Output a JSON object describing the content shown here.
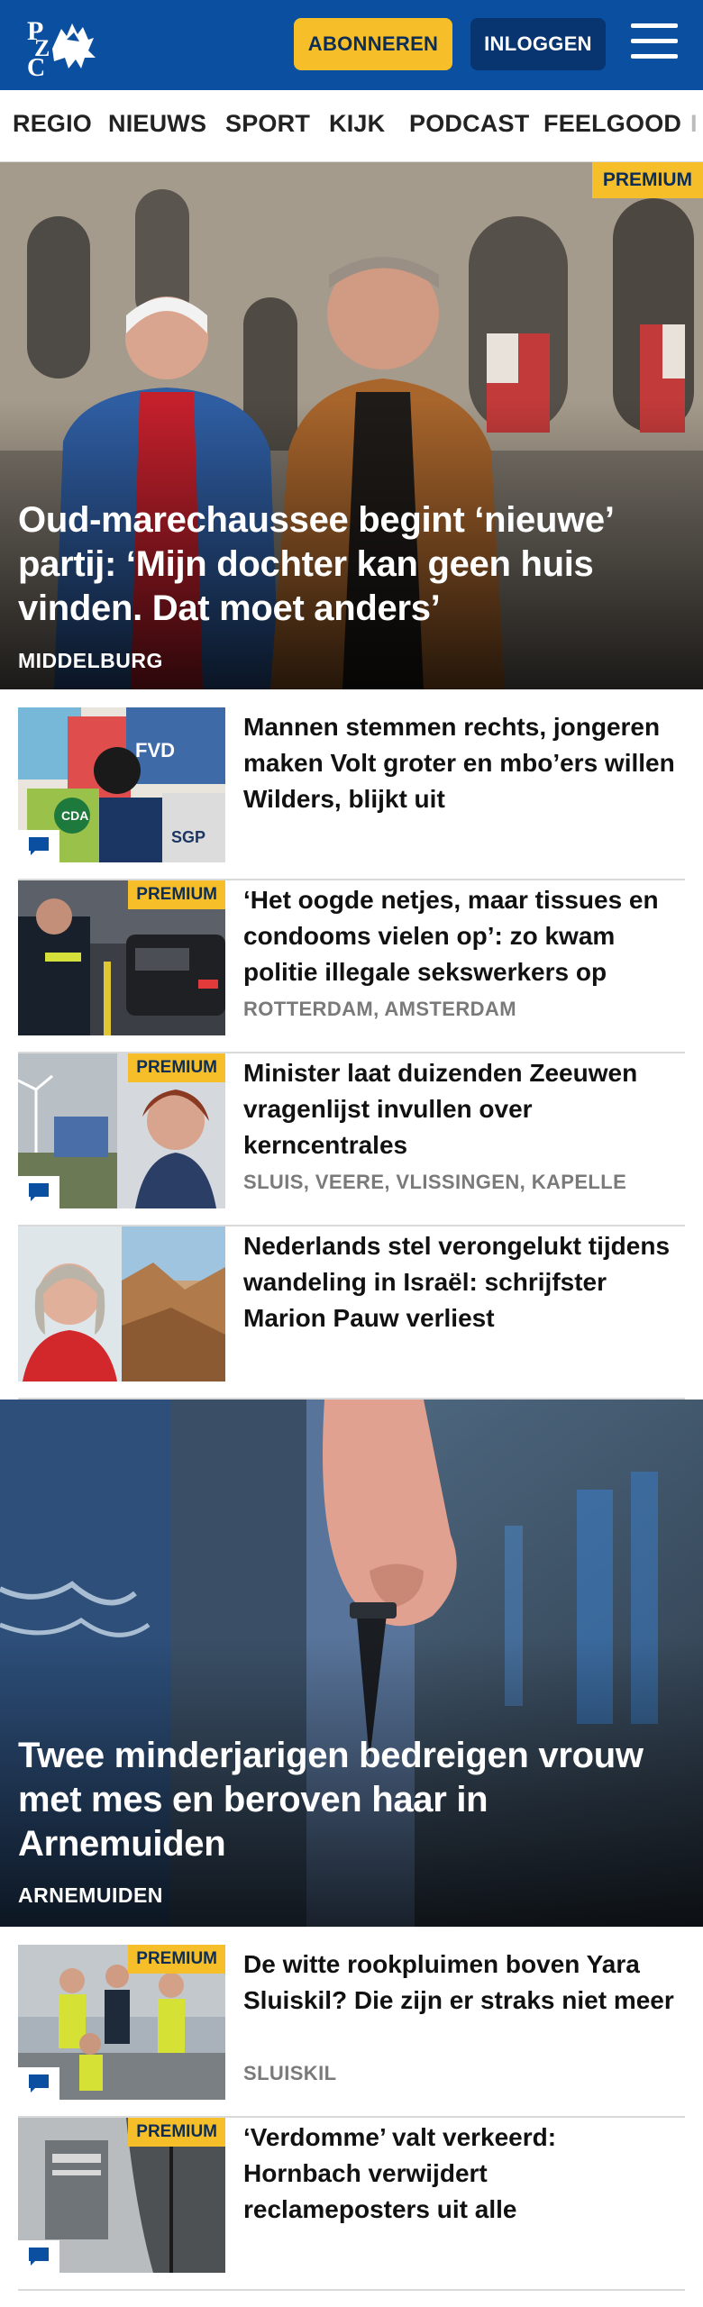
{
  "header": {
    "logo_text": "PZC",
    "subscribe_label": "ABONNEREN",
    "login_label": "INLOGGEN",
    "menu_icon": "hamburger-menu-icon",
    "colors": {
      "brand": "#0a4fa0",
      "accent": "#f6bf2a",
      "login_bg": "#08346f"
    }
  },
  "nav": {
    "items": [
      "REGIO",
      "NIEUWS",
      "SPORT",
      "KIJK",
      "PODCAST",
      "FEELGOOD",
      "I"
    ]
  },
  "hero1": {
    "badge": "PREMIUM",
    "title": "Oud-marechaussee begint ‘nieuwe’ partij: ‘Mijn dochter kan geen huis vinden. Dat moet anders’",
    "location": "MIDDELBURG"
  },
  "articles": [
    {
      "title": "Mannen stemmen rechts, jongeren maken Volt groter en mbo’ers willen Wilders, blijkt uit",
      "premium": "",
      "location": "",
      "comments": "comment-icon"
    },
    {
      "title": "‘Het oogde netjes, maar tissues en condooms vielen op’: zo kwam politie illegale sekswerkers op",
      "premium": "PREMIUM",
      "location": "ROTTERDAM, AMSTERDAM",
      "comments": ""
    },
    {
      "title": "Minister laat duizenden Zeeuwen vragenlijst invullen over kerncentrales",
      "premium": "PREMIUM",
      "location": "SLUIS, VEERE, VLISSINGEN, KAPELLE",
      "comments": "comment-icon"
    },
    {
      "title": "Nederlands stel verongelukt tijdens wandeling in Israël: schrijfster Marion Pauw verliest",
      "premium": "",
      "location": "",
      "comments": ""
    }
  ],
  "hero2": {
    "title": "Twee minderjarigen bedreigen vrouw met mes en beroven haar in Arnemuiden",
    "location": "ARNEMUIDEN"
  },
  "articles2": [
    {
      "title": "De witte rookpluimen boven Yara Sluiskil? Die zijn er straks niet meer",
      "premium": "PREMIUM",
      "location": "SLUISKIL",
      "comments": "comment-icon"
    },
    {
      "title": "‘Verdomme’ valt verkeerd: Hornbach verwijdert reclameposters uit alle",
      "premium": "PREMIUM",
      "location": "",
      "comments": "comment-icon"
    }
  ]
}
